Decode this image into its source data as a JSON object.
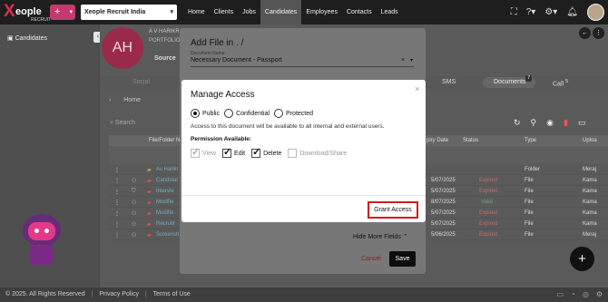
{
  "topbar": {
    "logo_mark": "X",
    "logo_word": "eople",
    "logo_sub": "RECRUIT",
    "add_button": "+",
    "org_select": "Xeople Recruit India",
    "nav": [
      "Home",
      "Clients",
      "Jobs",
      "Candidates",
      "Employees",
      "Contacts",
      "Leads"
    ],
    "active_nav": "Candidates"
  },
  "sidebar": {
    "item": "Candidates",
    "collapse": "‹"
  },
  "candidate": {
    "initials": "AH",
    "name": "A V HARIKR",
    "sub": "PORTFOLIO",
    "source": "Source"
  },
  "tabs": {
    "social": "Social",
    "sms": "SMS",
    "documents": "Documents",
    "documents_count": "7",
    "call": "Call",
    "call_count": "5"
  },
  "breadcrumb": {
    "home": "Home"
  },
  "search_label": "Search",
  "table": {
    "headers": [
      "File/Folder N",
      "piry Date",
      "Status",
      "Type",
      "Uploa"
    ],
    "rows": [
      {
        "name": "Av Harikr",
        "date": "",
        "status": "",
        "type": "Folder",
        "upl": "Meraj"
      },
      {
        "name": "Candidat",
        "date": "5/07/2025",
        "status": "Expired",
        "status_kind": "exp",
        "type": "File",
        "upl": "Kama"
      },
      {
        "name": "Intervie",
        "date": "5/07/2025",
        "status": "Expired",
        "status_kind": "exp",
        "type": "File",
        "upl": "Kama"
      },
      {
        "name": "Modifie",
        "date": "8/07/2025",
        "status": "Valid",
        "status_kind": "valid",
        "type": "File",
        "upl": "Kama"
      },
      {
        "name": "Modifie",
        "date": "5/07/2025",
        "status": "Expired",
        "status_kind": "exp",
        "type": "File",
        "upl": "Kama"
      },
      {
        "name": "Recruitr",
        "date": "5/07/2025",
        "status": "Expired",
        "status_kind": "exp",
        "type": "File",
        "upl": "Kama"
      },
      {
        "name": "Screensh",
        "date": "5/06/2025",
        "status": "Expired",
        "status_kind": "exp",
        "type": "File",
        "upl": "Meraj"
      }
    ]
  },
  "add_file": {
    "title": "Add File in . /",
    "doc_name_label": "Document Name",
    "doc_name_value": "Necessary Document - Passport",
    "hide_more": "Hide More Fields",
    "cancel": "Cancel",
    "save": "Save"
  },
  "manage_access": {
    "title": "Manage Access",
    "close": "×",
    "options": [
      "Public",
      "Confidential",
      "Protected"
    ],
    "selected": "Public",
    "description": "Access to this document will be available to all internal and external users.",
    "permission_label": "Permission Available:",
    "permissions": [
      {
        "label": "View",
        "checked": true,
        "disabled": true
      },
      {
        "label": "Edit",
        "checked": true,
        "disabled": false
      },
      {
        "label": "Delete",
        "checked": true,
        "disabled": false
      },
      {
        "label": "Download/Share",
        "checked": false,
        "disabled": true
      }
    ],
    "grant_button": "Grant Access",
    "highlight_color": "#d01c1c"
  },
  "footer": {
    "copyright": "© 2025. All Rights Reserved",
    "privacy": "Privacy Policy",
    "terms": "Terms of Use"
  },
  "fab": "+"
}
